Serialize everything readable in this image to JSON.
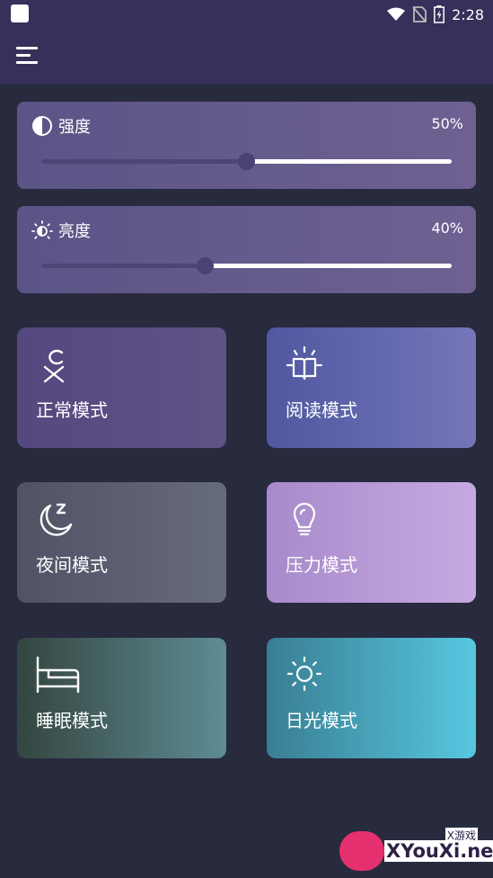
{
  "status_bar": {
    "time": "2:28"
  },
  "sliders": [
    {
      "label": "强度",
      "value_text": "50%",
      "value": 0.5,
      "icon": "contrast-icon"
    },
    {
      "label": "亮度",
      "value_text": "40%",
      "value": 0.4,
      "icon": "brightness-icon"
    }
  ],
  "modes": [
    {
      "label": "正常模式",
      "icon": "person-icon",
      "colors": [
        "#54487f",
        "#5f5285"
      ]
    },
    {
      "label": "阅读模式",
      "icon": "reading-lamp-icon",
      "colors": [
        "#5058a0",
        "#7476b8"
      ]
    },
    {
      "label": "夜间模式",
      "icon": "moon-sleep-icon",
      "colors": [
        "#505364",
        "#676b7e"
      ]
    },
    {
      "label": "压力模式",
      "icon": "lightbulb-icon",
      "colors": [
        "#a78acb",
        "#c7a9e1"
      ]
    },
    {
      "label": "睡眠模式",
      "icon": "bed-icon",
      "colors": [
        "#34453f",
        "#5e8c95"
      ]
    },
    {
      "label": "日光模式",
      "icon": "sun-icon",
      "colors": [
        "#397e92",
        "#57c7e0"
      ]
    }
  ],
  "watermark": {
    "site": "XYouXi.net",
    "cn": "X游戏"
  }
}
